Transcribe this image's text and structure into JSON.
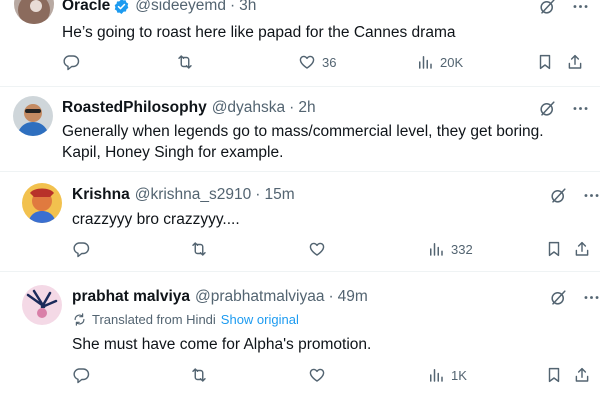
{
  "tweets": [
    {
      "name": "Oracle",
      "handle": "@sideeyemd",
      "time": "3h",
      "text": "He’s going to roast here like papad for the Cannes drama",
      "views": "20K",
      "likes": "36",
      "retweets": "",
      "replies": ""
    },
    {
      "name": "RoastedPhilosophy",
      "handle": "@dyahska",
      "time": "2h",
      "text_line1": "Generally when legends go to mass/commercial level, they get boring.",
      "text_line2": "Kapil, Honey Singh for example."
    },
    {
      "name": "Krishna",
      "handle": "@krishna_s2910",
      "time": "15m",
      "text": "crazzyyy bro crazzyyy....",
      "views": "332"
    },
    {
      "name": "prabhat malviya",
      "handle": "@prabhatmalviyaa",
      "time": "49m",
      "translated_label": "Translated from Hindi",
      "show_original": "Show original",
      "text": "She must have come for Alpha's promotion.",
      "views": "1K"
    }
  ],
  "separator": "·",
  "colors": {
    "text": "#0f1419",
    "secondary": "#536471",
    "accent": "#1d9bf0",
    "divider": "#eff3f4"
  },
  "icons": {
    "verified": "verified-badge-icon",
    "grok": "grok-icon",
    "more": "more-icon",
    "reply": "reply-icon",
    "retweet": "retweet-icon",
    "like": "like-icon",
    "views": "views-icon",
    "bookmark": "bookmark-icon",
    "share": "share-icon",
    "translate": "translate-icon"
  }
}
